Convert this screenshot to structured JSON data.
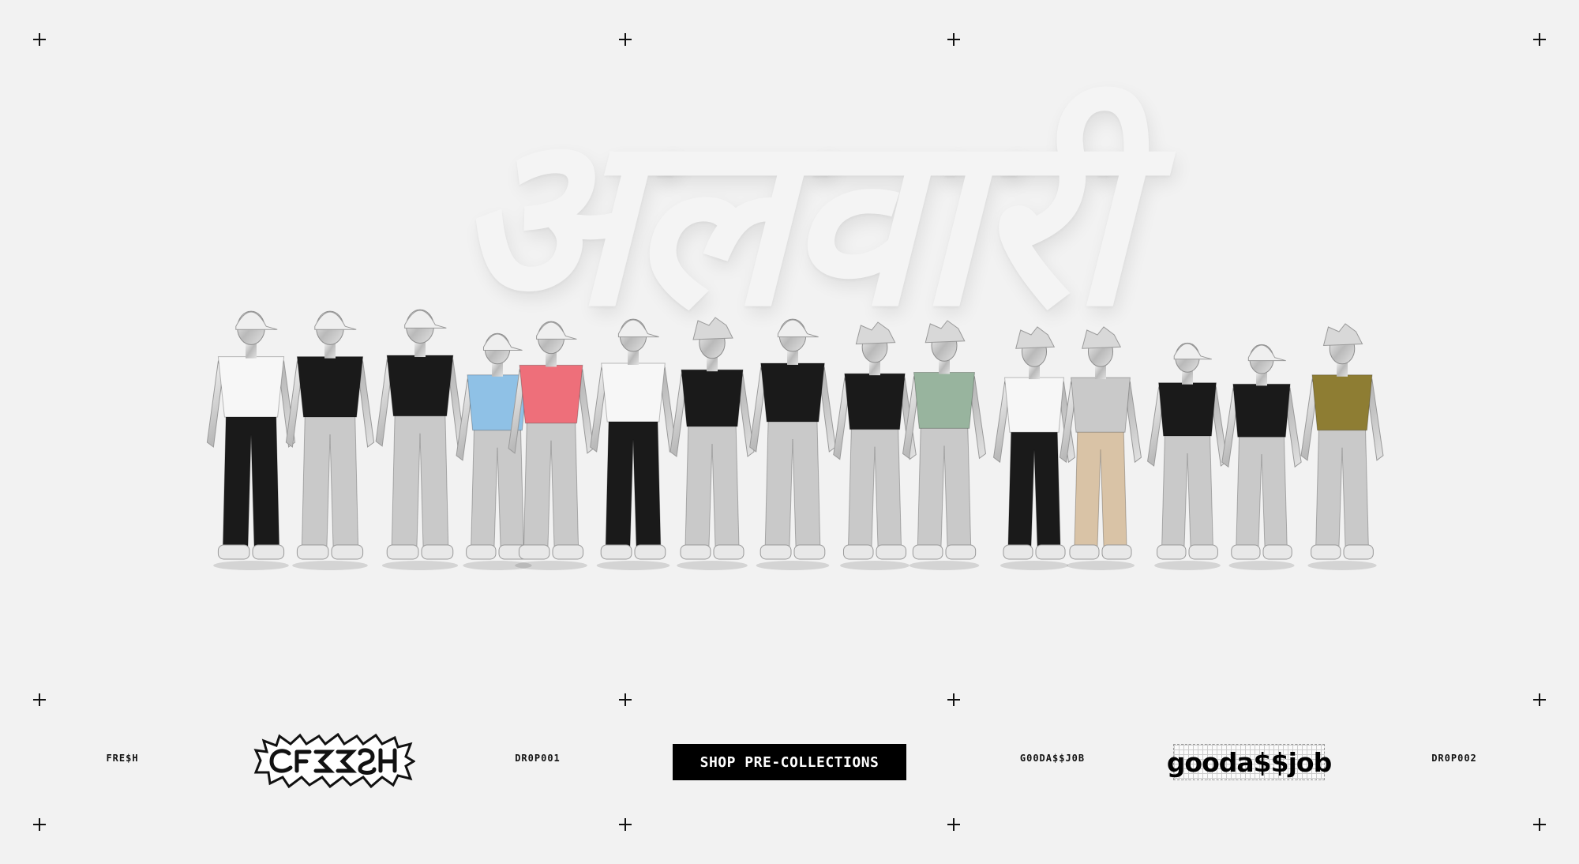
{
  "hero": {
    "title": "अलवारी",
    "figure_colors": {
      "silver": "#c9c9c9",
      "black": "#1a1a1a",
      "blue": "#8fc1e6",
      "red": "#ee6f7a",
      "green": "#98b49e",
      "olive": "#8e7d33",
      "beige": "#d9c3a6",
      "white": "#f7f7f7"
    }
  },
  "footer": {
    "left_label": "FRE$H",
    "left_logo_name": "fresh-logo",
    "drop_left": "DR0P001",
    "cta_label": "SHOP PRE-COLLECTIONS",
    "right_label": "G00DA$$J0B",
    "right_logo": "gooda$$job",
    "drop_right": "DR0P002"
  },
  "colors": {
    "background": "#f2f2f2",
    "cta_bg": "#000000",
    "cta_text": "#ffffff"
  }
}
